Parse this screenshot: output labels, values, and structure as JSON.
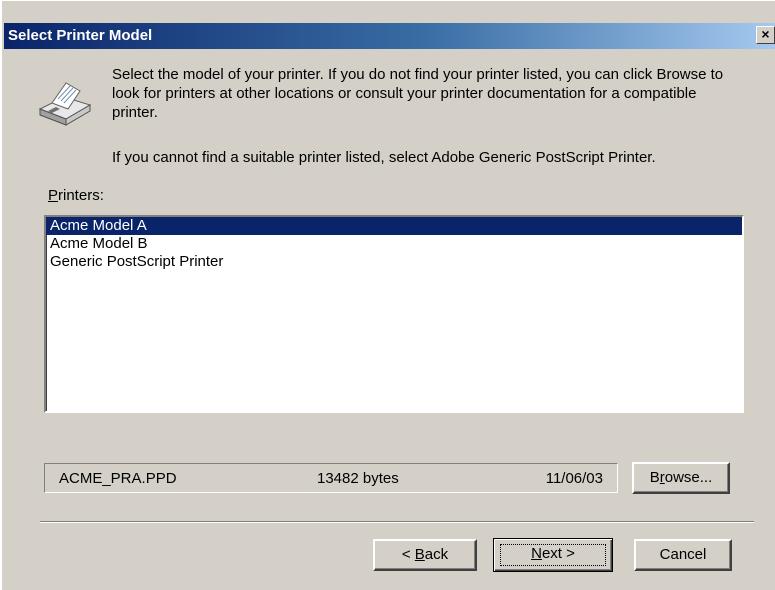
{
  "window": {
    "title": "Select Printer Model",
    "close_glyph": "×"
  },
  "header": {
    "description": "Select the model of your printer. If you do not find your printer listed, you can click Browse to look for printers at other locations or consult your printer documentation for a compatible printer.",
    "hint": "If you cannot find a suitable printer listed, select Adobe Generic PostScript Printer.",
    "icon": "printer-icon"
  },
  "printers": {
    "label_access_key": "P",
    "label_rest": "rinters:",
    "items": [
      {
        "label": "Acme Model A",
        "selected": true
      },
      {
        "label": "Acme Model B",
        "selected": false
      },
      {
        "label": "Generic PostScript Printer",
        "selected": false
      }
    ]
  },
  "file_info": {
    "filename": "ACME_PRA.PPD",
    "size": "13482 bytes",
    "date": "11/06/03"
  },
  "buttons": {
    "browse": {
      "pre": "B",
      "key": "r",
      "post": "owse..."
    },
    "back": {
      "pre": "< ",
      "key": "B",
      "post": "ack"
    },
    "next": {
      "pre": "",
      "key": "N",
      "post": "ext >"
    },
    "cancel": "Cancel"
  },
  "colors": {
    "selection": "#0a246a",
    "title_gradient_start": "#0a246a",
    "title_gradient_end": "#a6caf0",
    "face": "#d4d0c8"
  }
}
